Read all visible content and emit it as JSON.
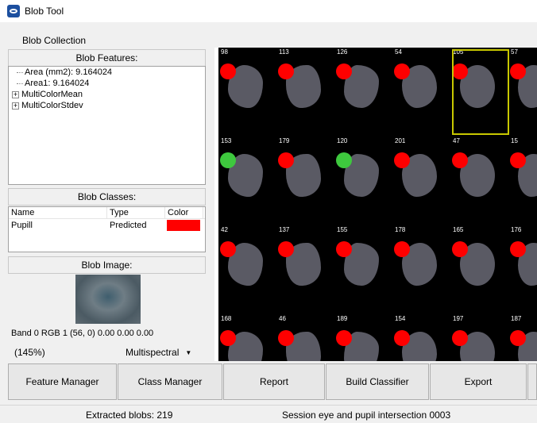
{
  "window": {
    "title": "Blob Tool",
    "icon": "eye-icon"
  },
  "menu": {
    "items": [
      "Blob Collection"
    ]
  },
  "features_panel": {
    "header": "Blob Features:",
    "tree": [
      {
        "label": "Area (mm2): 9.164024",
        "expandable": false
      },
      {
        "label": "Area1: 9.164024",
        "expandable": false
      },
      {
        "label": "MultiColorMean",
        "expandable": true
      },
      {
        "label": "MultiColorStdev",
        "expandable": true
      }
    ]
  },
  "classes_panel": {
    "header": "Blob Classes:",
    "columns": [
      "Name",
      "Type",
      "Color"
    ],
    "rows": [
      {
        "name": "Pupill",
        "type": "Predicted",
        "color": "#ff0000"
      }
    ]
  },
  "image_panel": {
    "header": "Blob Image:",
    "band_info": "Band 0  RGB 1  (56, 0)  0.00 0.00 0.00",
    "zoom": "(145%)",
    "mode": "Multispectral"
  },
  "blob_grid": {
    "cells": [
      {
        "number": "98",
        "status": "red"
      },
      {
        "number": "113",
        "status": "red"
      },
      {
        "number": "126",
        "status": "red"
      },
      {
        "number": "54",
        "status": "red"
      },
      {
        "number": "105",
        "status": "red"
      },
      {
        "number": "57",
        "status": "red"
      },
      {
        "number": "153",
        "status": "green"
      },
      {
        "number": "179",
        "status": "red"
      },
      {
        "number": "120",
        "status": "green"
      },
      {
        "number": "201",
        "status": "red"
      },
      {
        "number": "47",
        "status": "red"
      },
      {
        "number": "15",
        "status": "red"
      },
      {
        "number": "42",
        "status": "red"
      },
      {
        "number": "137",
        "status": "red"
      },
      {
        "number": "155",
        "status": "red"
      },
      {
        "number": "178",
        "status": "red"
      },
      {
        "number": "165",
        "status": "red"
      },
      {
        "number": "176",
        "status": "red"
      },
      {
        "number": "168",
        "status": "red"
      },
      {
        "number": "46",
        "status": "red"
      },
      {
        "number": "189",
        "status": "red"
      },
      {
        "number": "154",
        "status": "red"
      },
      {
        "number": "197",
        "status": "red"
      },
      {
        "number": "187",
        "status": "red"
      }
    ],
    "selected_number": "105"
  },
  "buttons": {
    "feature_manager": "Feature Manager",
    "class_manager": "Class Manager",
    "report": "Report",
    "build_classifier": "Build Classifier",
    "export": "Export"
  },
  "status": {
    "extracted": "Extracted blobs: 219",
    "session": "Session eye and pupil intersection 0003"
  }
}
